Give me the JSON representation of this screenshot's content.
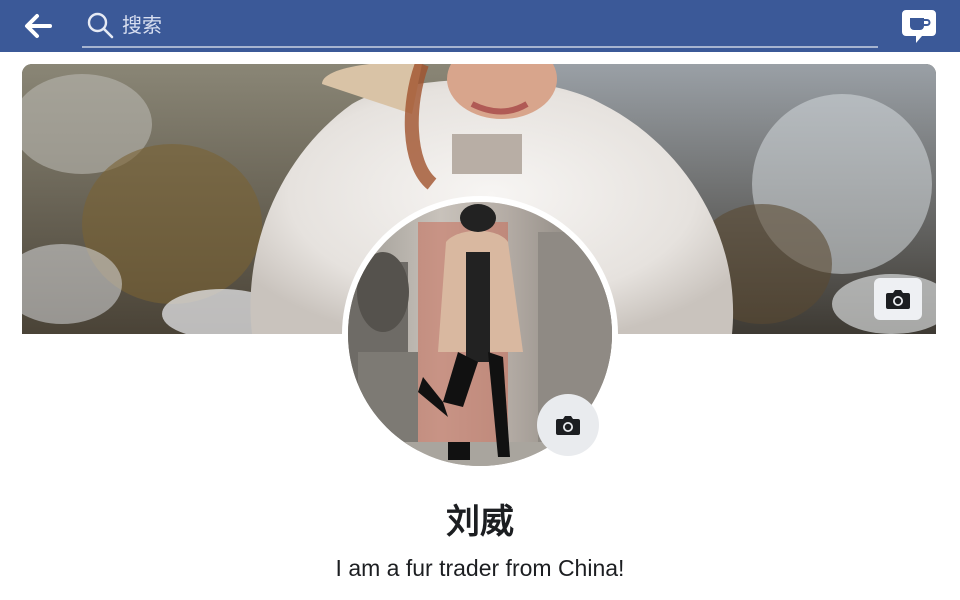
{
  "colors": {
    "brand": "#3b5998",
    "page_background": "#ffffff",
    "text": "#1c1e21"
  },
  "header": {
    "back_icon": "arrow-left-icon",
    "search": {
      "placeholder": "搜索",
      "value": "",
      "icon": "search-icon"
    },
    "messenger_icon": "messenger-icon"
  },
  "cover": {
    "camera_icon": "camera-icon"
  },
  "profile_picture": {
    "camera_icon": "camera-icon"
  },
  "profile": {
    "name": "刘威",
    "bio": "I am a fur trader from China!"
  }
}
